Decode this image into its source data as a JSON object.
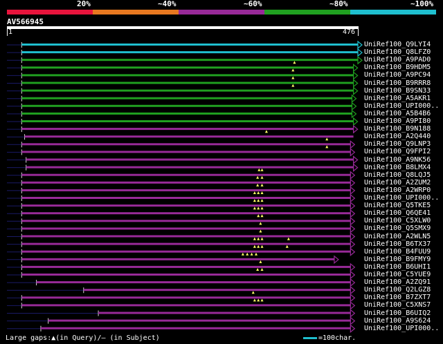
{
  "legend": {
    "segments": [
      {
        "color": "#e8143c",
        "label": "20%"
      },
      {
        "color": "#e87820",
        "label": "~40%"
      },
      {
        "color": "#982a98",
        "label": "~60%"
      },
      {
        "color": "#20a020",
        "label": "~80%"
      },
      {
        "color": "#1fbfcf",
        "label": "~100%"
      }
    ]
  },
  "query": {
    "name": "AV566945",
    "start": "1",
    "end": "476"
  },
  "colors": {
    "cyan": "#1fbfcf",
    "green": "#20a020",
    "purple": "#982a98",
    "gap": "#ffff66",
    "tail": "#1a1a66"
  },
  "hits": [
    {
      "label": "UniRef100_Q9LYI4",
      "color": "cyan",
      "s": 20,
      "e": 476,
      "arrow": true,
      "gaps": []
    },
    {
      "label": "UniRef100_Q8LFZ0",
      "color": "cyan",
      "s": 20,
      "e": 476,
      "arrow": true,
      "gaps": []
    },
    {
      "label": "UniRef100_A9PAD0",
      "color": "green",
      "s": 20,
      "e": 476,
      "arrow": true,
      "gaps": []
    },
    {
      "label": "UniRef100_B9HDM5",
      "color": "green",
      "s": 20,
      "e": 470,
      "arrow": true,
      "gaps": [
        390
      ]
    },
    {
      "label": "UniRef100_A9PC94",
      "color": "green",
      "s": 20,
      "e": 470,
      "arrow": true,
      "gaps": [
        388
      ]
    },
    {
      "label": "UniRef100_B9RRR8",
      "color": "green",
      "s": 20,
      "e": 470,
      "arrow": true,
      "gaps": [
        388
      ]
    },
    {
      "label": "UniRef100_B9SN33",
      "color": "green",
      "s": 20,
      "e": 470,
      "arrow": true,
      "gaps": [
        388
      ]
    },
    {
      "label": "UniRef100_A5AKR1",
      "color": "green",
      "s": 20,
      "e": 468,
      "arrow": true,
      "gaps": []
    },
    {
      "label": "UniRef100_UPI000..",
      "color": "green",
      "s": 20,
      "e": 468,
      "arrow": true,
      "gaps": []
    },
    {
      "label": "UniRef100_A5B4B6",
      "color": "green",
      "s": 20,
      "e": 468,
      "arrow": true,
      "gaps": []
    },
    {
      "label": "UniRef100_A9PI80",
      "color": "green",
      "s": 20,
      "e": 470,
      "arrow": true,
      "gaps": []
    },
    {
      "label": "UniRef100_B9N188",
      "color": "purple",
      "s": 20,
      "e": 470,
      "arrow": true,
      "gaps": []
    },
    {
      "label": "UniRef100_A2Q440",
      "color": "purple",
      "s": 24,
      "e": 470,
      "arrow": false,
      "gaps": [
        352
      ]
    },
    {
      "label": "UniRef100_Q9LNP3",
      "color": "purple",
      "s": 20,
      "e": 466,
      "arrow": true,
      "gaps": [
        434
      ]
    },
    {
      "label": "UniRef100_Q9FPI2",
      "color": "purple",
      "s": 20,
      "e": 466,
      "arrow": true,
      "gaps": [
        434
      ]
    },
    {
      "label": "UniRef100_A9NK56",
      "color": "purple",
      "s": 26,
      "e": 470,
      "arrow": true,
      "gaps": []
    },
    {
      "label": "UniRef100_B8LMX4",
      "color": "purple",
      "s": 26,
      "e": 470,
      "arrow": true,
      "gaps": []
    },
    {
      "label": "UniRef100_Q8LQJ5",
      "color": "purple",
      "s": 20,
      "e": 466,
      "arrow": true,
      "gaps": [
        342,
        346
      ]
    },
    {
      "label": "UniRef100_A2ZUM2",
      "color": "purple",
      "s": 20,
      "e": 466,
      "arrow": true,
      "gaps": [
        340,
        346
      ]
    },
    {
      "label": "UniRef100_A2WRP0",
      "color": "purple",
      "s": 20,
      "e": 466,
      "arrow": true,
      "gaps": [
        340,
        346
      ]
    },
    {
      "label": "UniRef100_UPI000..",
      "color": "purple",
      "s": 20,
      "e": 466,
      "arrow": true,
      "gaps": [
        336,
        341,
        346
      ]
    },
    {
      "label": "UniRef100_Q5TKE5",
      "color": "purple",
      "s": 20,
      "e": 466,
      "arrow": true,
      "gaps": [
        336,
        341,
        346
      ]
    },
    {
      "label": "UniRef100_Q6QE41",
      "color": "purple",
      "s": 20,
      "e": 466,
      "arrow": true,
      "gaps": [
        336,
        341,
        346
      ]
    },
    {
      "label": "UniRef100_C5XLW0",
      "color": "purple",
      "s": 20,
      "e": 466,
      "arrow": true,
      "gaps": [
        341,
        346
      ]
    },
    {
      "label": "UniRef100_Q5SMX9",
      "color": "purple",
      "s": 20,
      "e": 466,
      "arrow": true,
      "gaps": [
        344
      ]
    },
    {
      "label": "UniRef100_A2WLN5",
      "color": "purple",
      "s": 20,
      "e": 466,
      "arrow": true,
      "gaps": [
        344
      ]
    },
    {
      "label": "UniRef100_B6TX37",
      "color": "purple",
      "s": 20,
      "e": 466,
      "arrow": true,
      "gaps": [
        336,
        341,
        346,
        382
      ]
    },
    {
      "label": "UniRef100_B4FUU9",
      "color": "purple",
      "s": 20,
      "e": 466,
      "arrow": true,
      "gaps": [
        336,
        341,
        346,
        380
      ]
    },
    {
      "label": "UniRef100_B9FMY9",
      "color": "purple",
      "s": 20,
      "e": 444,
      "arrow": true,
      "gaps": [
        320,
        326,
        332,
        338
      ]
    },
    {
      "label": "UniRef100_B6UHI1",
      "color": "purple",
      "s": 20,
      "e": 466,
      "arrow": true,
      "gaps": [
        344
      ]
    },
    {
      "label": "UniRef100_C5YUE9",
      "color": "purple",
      "s": 20,
      "e": 466,
      "arrow": true,
      "gaps": [
        340,
        346
      ]
    },
    {
      "label": "UniRef100_A2ZQ91",
      "color": "purple",
      "s": 40,
      "e": 466,
      "arrow": true,
      "gaps": []
    },
    {
      "label": "UniRef100_Q2LGZ8",
      "color": "purple",
      "s": 104,
      "e": 466,
      "arrow": true,
      "gaps": []
    },
    {
      "label": "UniRef100_B7ZXT7",
      "color": "purple",
      "s": 20,
      "e": 466,
      "arrow": true,
      "gaps": [
        334
      ]
    },
    {
      "label": "UniRef100_C5XNS7",
      "color": "purple",
      "s": 20,
      "e": 466,
      "arrow": true,
      "gaps": [
        336,
        341,
        346
      ]
    },
    {
      "label": "UniRef100_B6UIQ2",
      "color": "purple",
      "s": 124,
      "e": 466,
      "arrow": true,
      "gaps": []
    },
    {
      "label": "UniRef100_A9S624",
      "color": "purple",
      "s": 56,
      "e": 466,
      "arrow": true,
      "gaps": []
    },
    {
      "label": "UniRef100_UPI000..",
      "color": "purple",
      "s": 46,
      "e": 466,
      "arrow": true,
      "gaps": []
    }
  ],
  "footer": {
    "gaps_text": "Large gaps:▲(in Query)/— (in Subject)",
    "scale_text": "=100char."
  }
}
